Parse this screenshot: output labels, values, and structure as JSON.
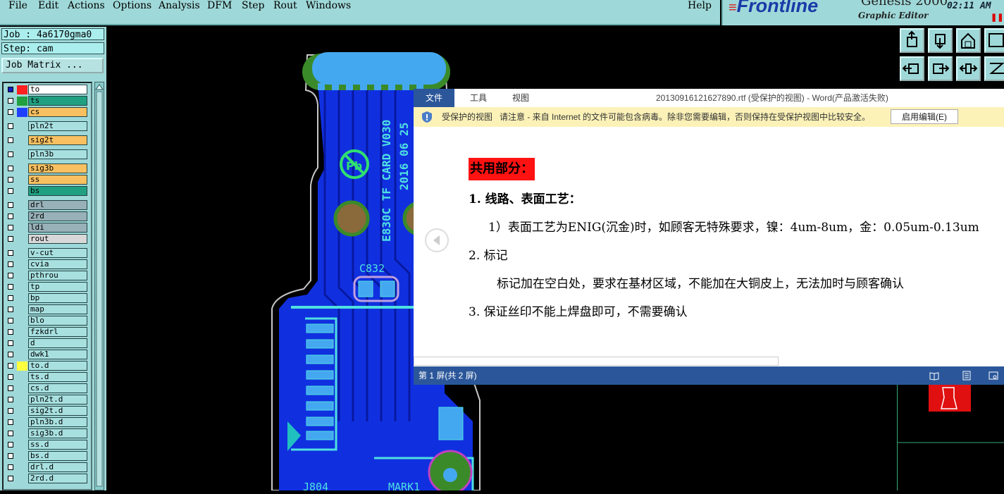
{
  "menu": {
    "items": [
      "File",
      "Edit",
      "Actions",
      "Options",
      "Analysis",
      "DFM",
      "Step",
      "Rout",
      "Windows"
    ],
    "help": "Help"
  },
  "brand": {
    "logo": "Frontline",
    "product": "Genesis 2000",
    "subtitle": "Graphic Editor",
    "clock": "02:11 AM"
  },
  "job": {
    "job_line": "Job : 4a6170gma0",
    "step_line": "Step: cam",
    "matrix_button": "Job Matrix ..."
  },
  "layers": [
    {
      "name": "to",
      "color": "#ffffff",
      "swatch": "#ff2020",
      "checked": true
    },
    {
      "name": "ts",
      "color": "#20a080",
      "swatch": "#20a040"
    },
    {
      "name": "cs",
      "color": "#f8c060",
      "swatch": "#2040ff"
    },
    {
      "name": "pln2t",
      "color": "#a8e0e0"
    },
    {
      "name": "sig2t",
      "color": "#f8c060"
    },
    {
      "name": "pln3b",
      "color": "#a8e0e0"
    },
    {
      "name": "sig3b",
      "color": "#f8c060"
    },
    {
      "name": "ss",
      "color": "#f8c060"
    },
    {
      "name": "bs",
      "color": "#20a080"
    },
    {
      "name": "drl",
      "color": "#98b0b8"
    },
    {
      "name": "2rd",
      "color": "#98b0b8"
    },
    {
      "name": "ldi",
      "color": "#98b0b8"
    },
    {
      "name": "rout",
      "color": "#d8d8d8"
    },
    {
      "name": "v-cut",
      "color": "#a8e0e0"
    },
    {
      "name": "cvia",
      "color": "#a8e0e0"
    },
    {
      "name": "pthrou",
      "color": "#a8e0e0"
    },
    {
      "name": "tp",
      "color": "#a8e0e0"
    },
    {
      "name": "bp",
      "color": "#a8e0e0"
    },
    {
      "name": "map",
      "color": "#a8e0e0"
    },
    {
      "name": "blo",
      "color": "#a8e0e0"
    },
    {
      "name": "fzkdrl",
      "color": "#a8e0e0"
    },
    {
      "name": "d",
      "color": "#a8e0e0"
    },
    {
      "name": "dwk1",
      "color": "#a8e0e0"
    },
    {
      "name": "to.d",
      "color": "#a8e0e0",
      "swatch": "#ffff40"
    },
    {
      "name": "ts.d",
      "color": "#a8e0e0"
    },
    {
      "name": "cs.d",
      "color": "#a8e0e0"
    },
    {
      "name": "pln2t.d",
      "color": "#a8e0e0"
    },
    {
      "name": "sig2t.d",
      "color": "#a8e0e0"
    },
    {
      "name": "pln3b.d",
      "color": "#a8e0e0"
    },
    {
      "name": "sig3b.d",
      "color": "#a8e0e0"
    },
    {
      "name": "ss.d",
      "color": "#a8e0e0"
    },
    {
      "name": "bs.d",
      "color": "#a8e0e0"
    },
    {
      "name": "drl.d",
      "color": "#a8e0e0"
    },
    {
      "name": "2rd.d",
      "color": "#a8e0e0"
    }
  ],
  "pcb": {
    "labels": [
      "E830C TF CARD V030",
      "2016 06 25",
      "C832",
      "J804",
      "MARK1",
      "Pb"
    ]
  },
  "word": {
    "tabs": [
      "文件",
      "工具",
      "视图"
    ],
    "title": "20130916121627890.rtf (受保护的视图) - Word(产品激活失败)",
    "msg_title": "受保护的视图",
    "msg_text": "请注意 - 来自 Internet 的文件可能包含病毒。除非您需要编辑，否则保持在受保护视图中比较安全。",
    "enable_button": "启用编辑(E)",
    "heading": "共用部分：",
    "lines": [
      "1. 线路、表面工艺：",
      "1）表面工艺为ENIG(沉金)时，如顾客无特殊要求，镍：4um-8um，金：0.05um-0.13um",
      "2.  标记",
      "标记加在空白处，要求在基材区域，不能加在大铜皮上，无法加时与顾客确认",
      "3. 保证丝印不能上焊盘即可，不需要确认"
    ],
    "status": "第 1 屏(共 2 屏)"
  },
  "colors": {
    "panel": "#9fd8d8",
    "word_accent": "#2b579a",
    "highlight": "#ff1212",
    "pcb_copper": "#1030e0"
  }
}
